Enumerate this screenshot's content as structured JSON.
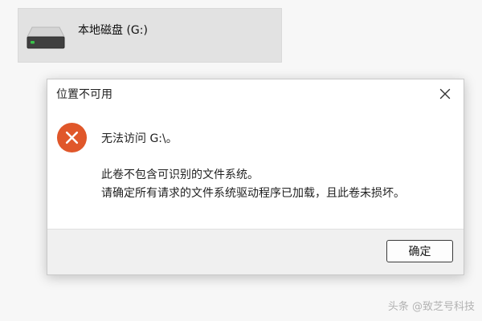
{
  "drive": {
    "label": "本地磁盘 (G:)",
    "icon": "drive-icon"
  },
  "dialog": {
    "title": "位置不可用",
    "close_icon": "close-icon",
    "error_icon": "error-icon",
    "message_title": "无法访问 G:\\。",
    "message_line1": "此卷不包含可识别的文件系统。",
    "message_line2": "请确定所有请求的文件系统驱动程序已加载，且此卷未损坏。",
    "ok_label": "确定"
  },
  "watermark": {
    "text": "头条 @致芝号科技"
  },
  "colors": {
    "error_red": "#e0572a",
    "footer_bg": "#f0f0f0",
    "drive_tile_bg": "#e2e2e2"
  }
}
